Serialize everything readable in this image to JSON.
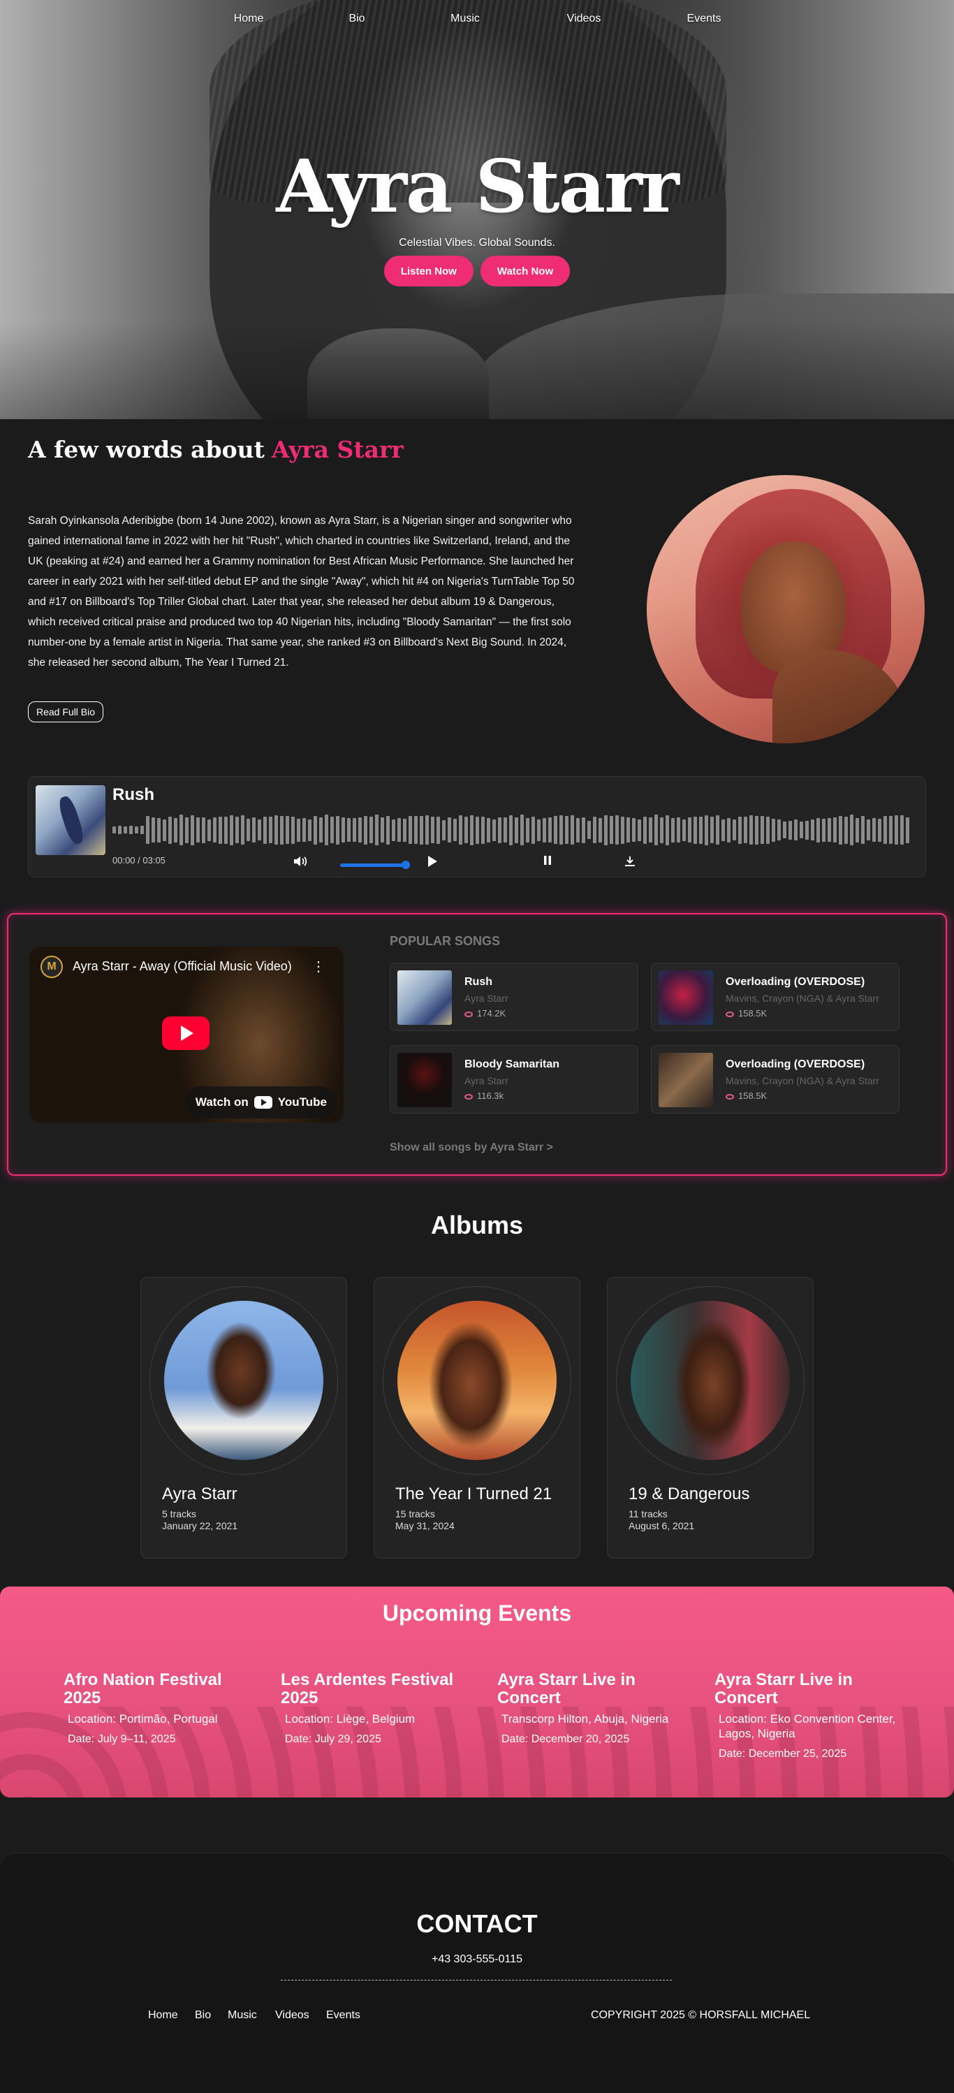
{
  "nav": {
    "items": [
      "Home",
      "Bio",
      "Music",
      "Videos",
      "Events"
    ]
  },
  "hero": {
    "title": "Ayra Starr",
    "tagline": "Celestial Vibes. Global Sounds.",
    "listen_label": "Listen Now",
    "watch_label": "Watch Now"
  },
  "bio": {
    "heading_prefix": "A few words about",
    "heading_name": "Ayra Starr",
    "text": "Sarah Oyinkansola Aderibigbe (born 14 June 2002), known as Ayra Starr, is a Nigerian singer and songwriter who gained international fame in 2022 with her hit \"Rush\", which charted in countries like Switzerland, Ireland, and the UK (peaking at #24) and earned her a Grammy nomination for Best African Music Performance. She launched her career in early 2021 with her self-titled debut EP and the single \"Away\", which hit #4 on Nigeria's TurnTable Top 50 and #17 on Billboard's Top Triller Global chart. Later that year, she released her debut album 19 & Dangerous, which received critical praise and produced two top 40 Nigerian hits, including \"Bloody Samaritan\" — the first solo number-one by a female artist in Nigeria. That same year, she ranked #3 on Billboard's Next Big Sound. In 2024, she released her second album, The Year I Turned 21.",
    "read_more_label": "Read Full Bio"
  },
  "player": {
    "track_title": "Rush",
    "time": "00:00 / 03:05",
    "progress": 0.0,
    "volume": 0.9,
    "icons": [
      "volume-icon",
      "play-icon",
      "pause-icon",
      "download-icon"
    ],
    "accent": "#1e72e6"
  },
  "video": {
    "title": "Ayra Starr - Away (Official Music Video)",
    "channel_initial": "M",
    "watch_on": "Watch on",
    "platform": "YouTube"
  },
  "popular": {
    "heading": "POPULAR SONGS",
    "songs": [
      {
        "title": "Rush",
        "artist": "Ayra Starr",
        "plays": "174.2K"
      },
      {
        "title": "Overloading (OVERDOSE)",
        "artist": "Mavins, Crayon (NGA) & Ayra Starr",
        "plays": "158.5K"
      },
      {
        "title": "Bloody Samaritan",
        "artist": "Ayra Starr",
        "plays": "116.3k"
      },
      {
        "title": "Overloading (OVERDOSE)",
        "artist": "Mavins, Crayon (NGA) & Ayra Starr",
        "plays": "158.5K"
      }
    ],
    "show_all": "Show all songs by Ayra Starr >"
  },
  "albums": {
    "heading": "Albums",
    "items": [
      {
        "name": "Ayra Starr",
        "tracks": "5 tracks",
        "date": "January 22, 2021"
      },
      {
        "name": "The Year I Turned 21",
        "tracks": "15 tracks",
        "date": "May 31, 2024"
      },
      {
        "name": "19 & Dangerous",
        "tracks": "11 tracks",
        "date": "August 6, 2021"
      }
    ]
  },
  "events": {
    "heading": "Upcoming Events",
    "items": [
      {
        "name": "Afro Nation Festival 2025",
        "location": "Location: Portimão, Portugal",
        "date": "Date: July 9–11, 2025"
      },
      {
        "name": "Les Ardentes Festival 2025",
        "location": "Location: Liège, Belgium",
        "date": "Date: July 29, 2025"
      },
      {
        "name": "Ayra Starr Live in Concert",
        "location": "Transcorp Hilton, Abuja, Nigeria",
        "date": "Date: December 20, 2025"
      },
      {
        "name": "Ayra Starr Live in Concert",
        "location": "Location: Eko Convention Center, Lagos, Nigeria",
        "date": "Date: December 25, 2025"
      }
    ]
  },
  "footer": {
    "contact_heading": "CONTACT",
    "phone": "+43 303-555-0115",
    "nav": [
      "Home",
      "Bio",
      "Music",
      "Videos",
      "Events"
    ],
    "copyright": "COPYRIGHT 2025 © HORSFALL MICHAEL"
  },
  "colors": {
    "accent": "#ee2d74",
    "background": "#1b1b1c",
    "events_bg": "#f05883"
  }
}
